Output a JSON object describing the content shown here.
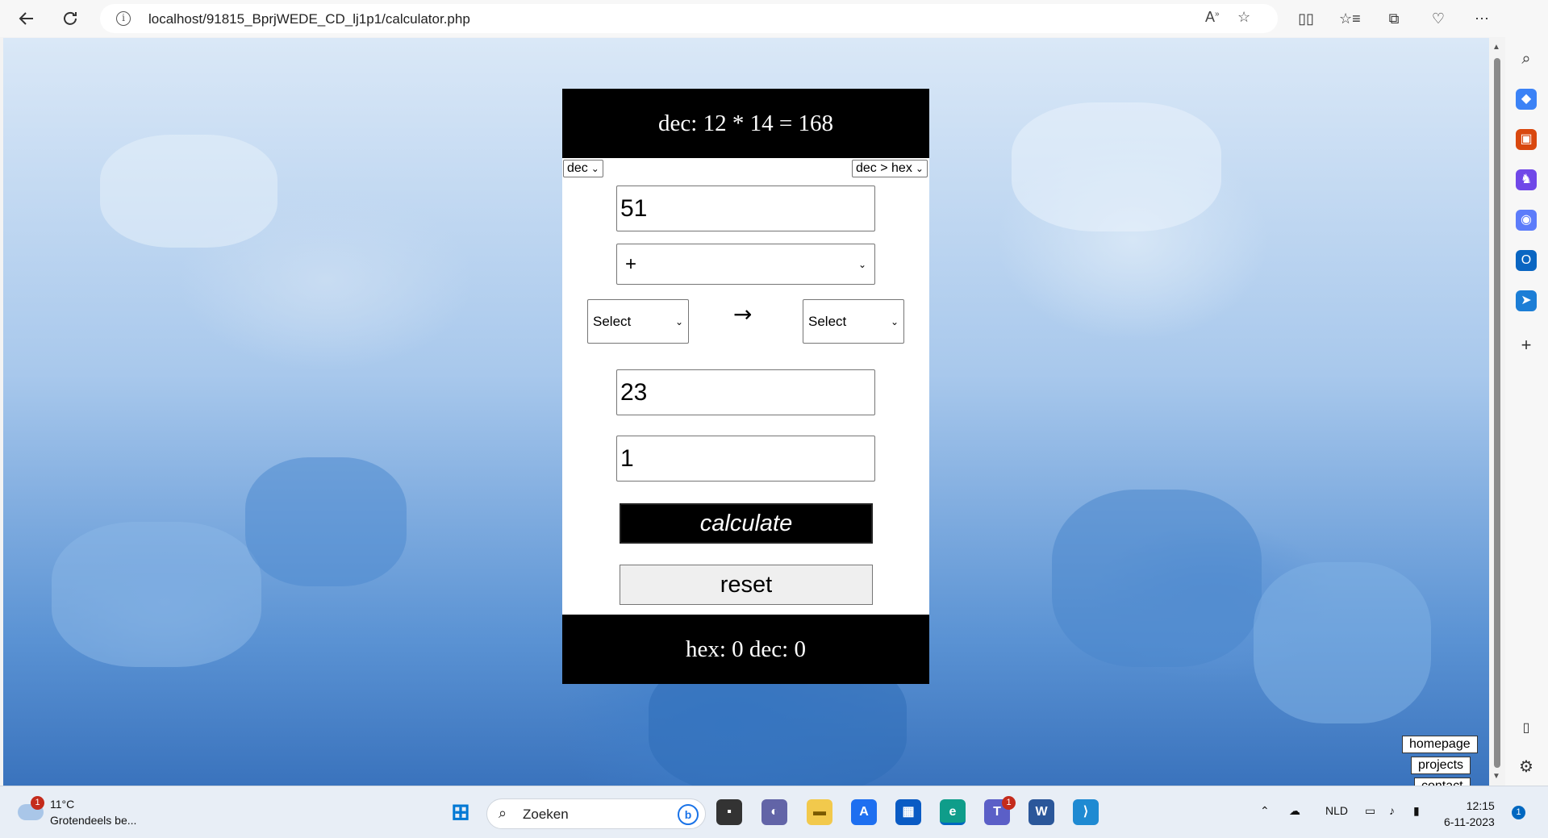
{
  "browser": {
    "url": "localhost/91815_BprjWEDE_CD_lj1p1/calculator.php"
  },
  "calculator": {
    "top_display": "dec: 12 * 14 = 168",
    "mode_select": "dec",
    "conversion_select": "dec > hex",
    "input_first": "51",
    "operator_select": "+",
    "from_select": "Select",
    "arrow": "→",
    "to_select": "Select",
    "input_second": "23",
    "input_third": "1",
    "calculate_label": "calculate",
    "reset_label": "reset",
    "bottom_display": "hex: 0 dec: 0"
  },
  "nav": {
    "homepage": "homepage",
    "projects": "projects",
    "contact": "contact"
  },
  "taskbar": {
    "weather_badge": "1",
    "temperature": "11°C",
    "weather_desc": "Grotendeels be...",
    "search_placeholder": "Zoeken",
    "teams_badge": "1",
    "language": "NLD",
    "time": "12:15",
    "date": "6-11-2023",
    "notification_count": "1"
  }
}
